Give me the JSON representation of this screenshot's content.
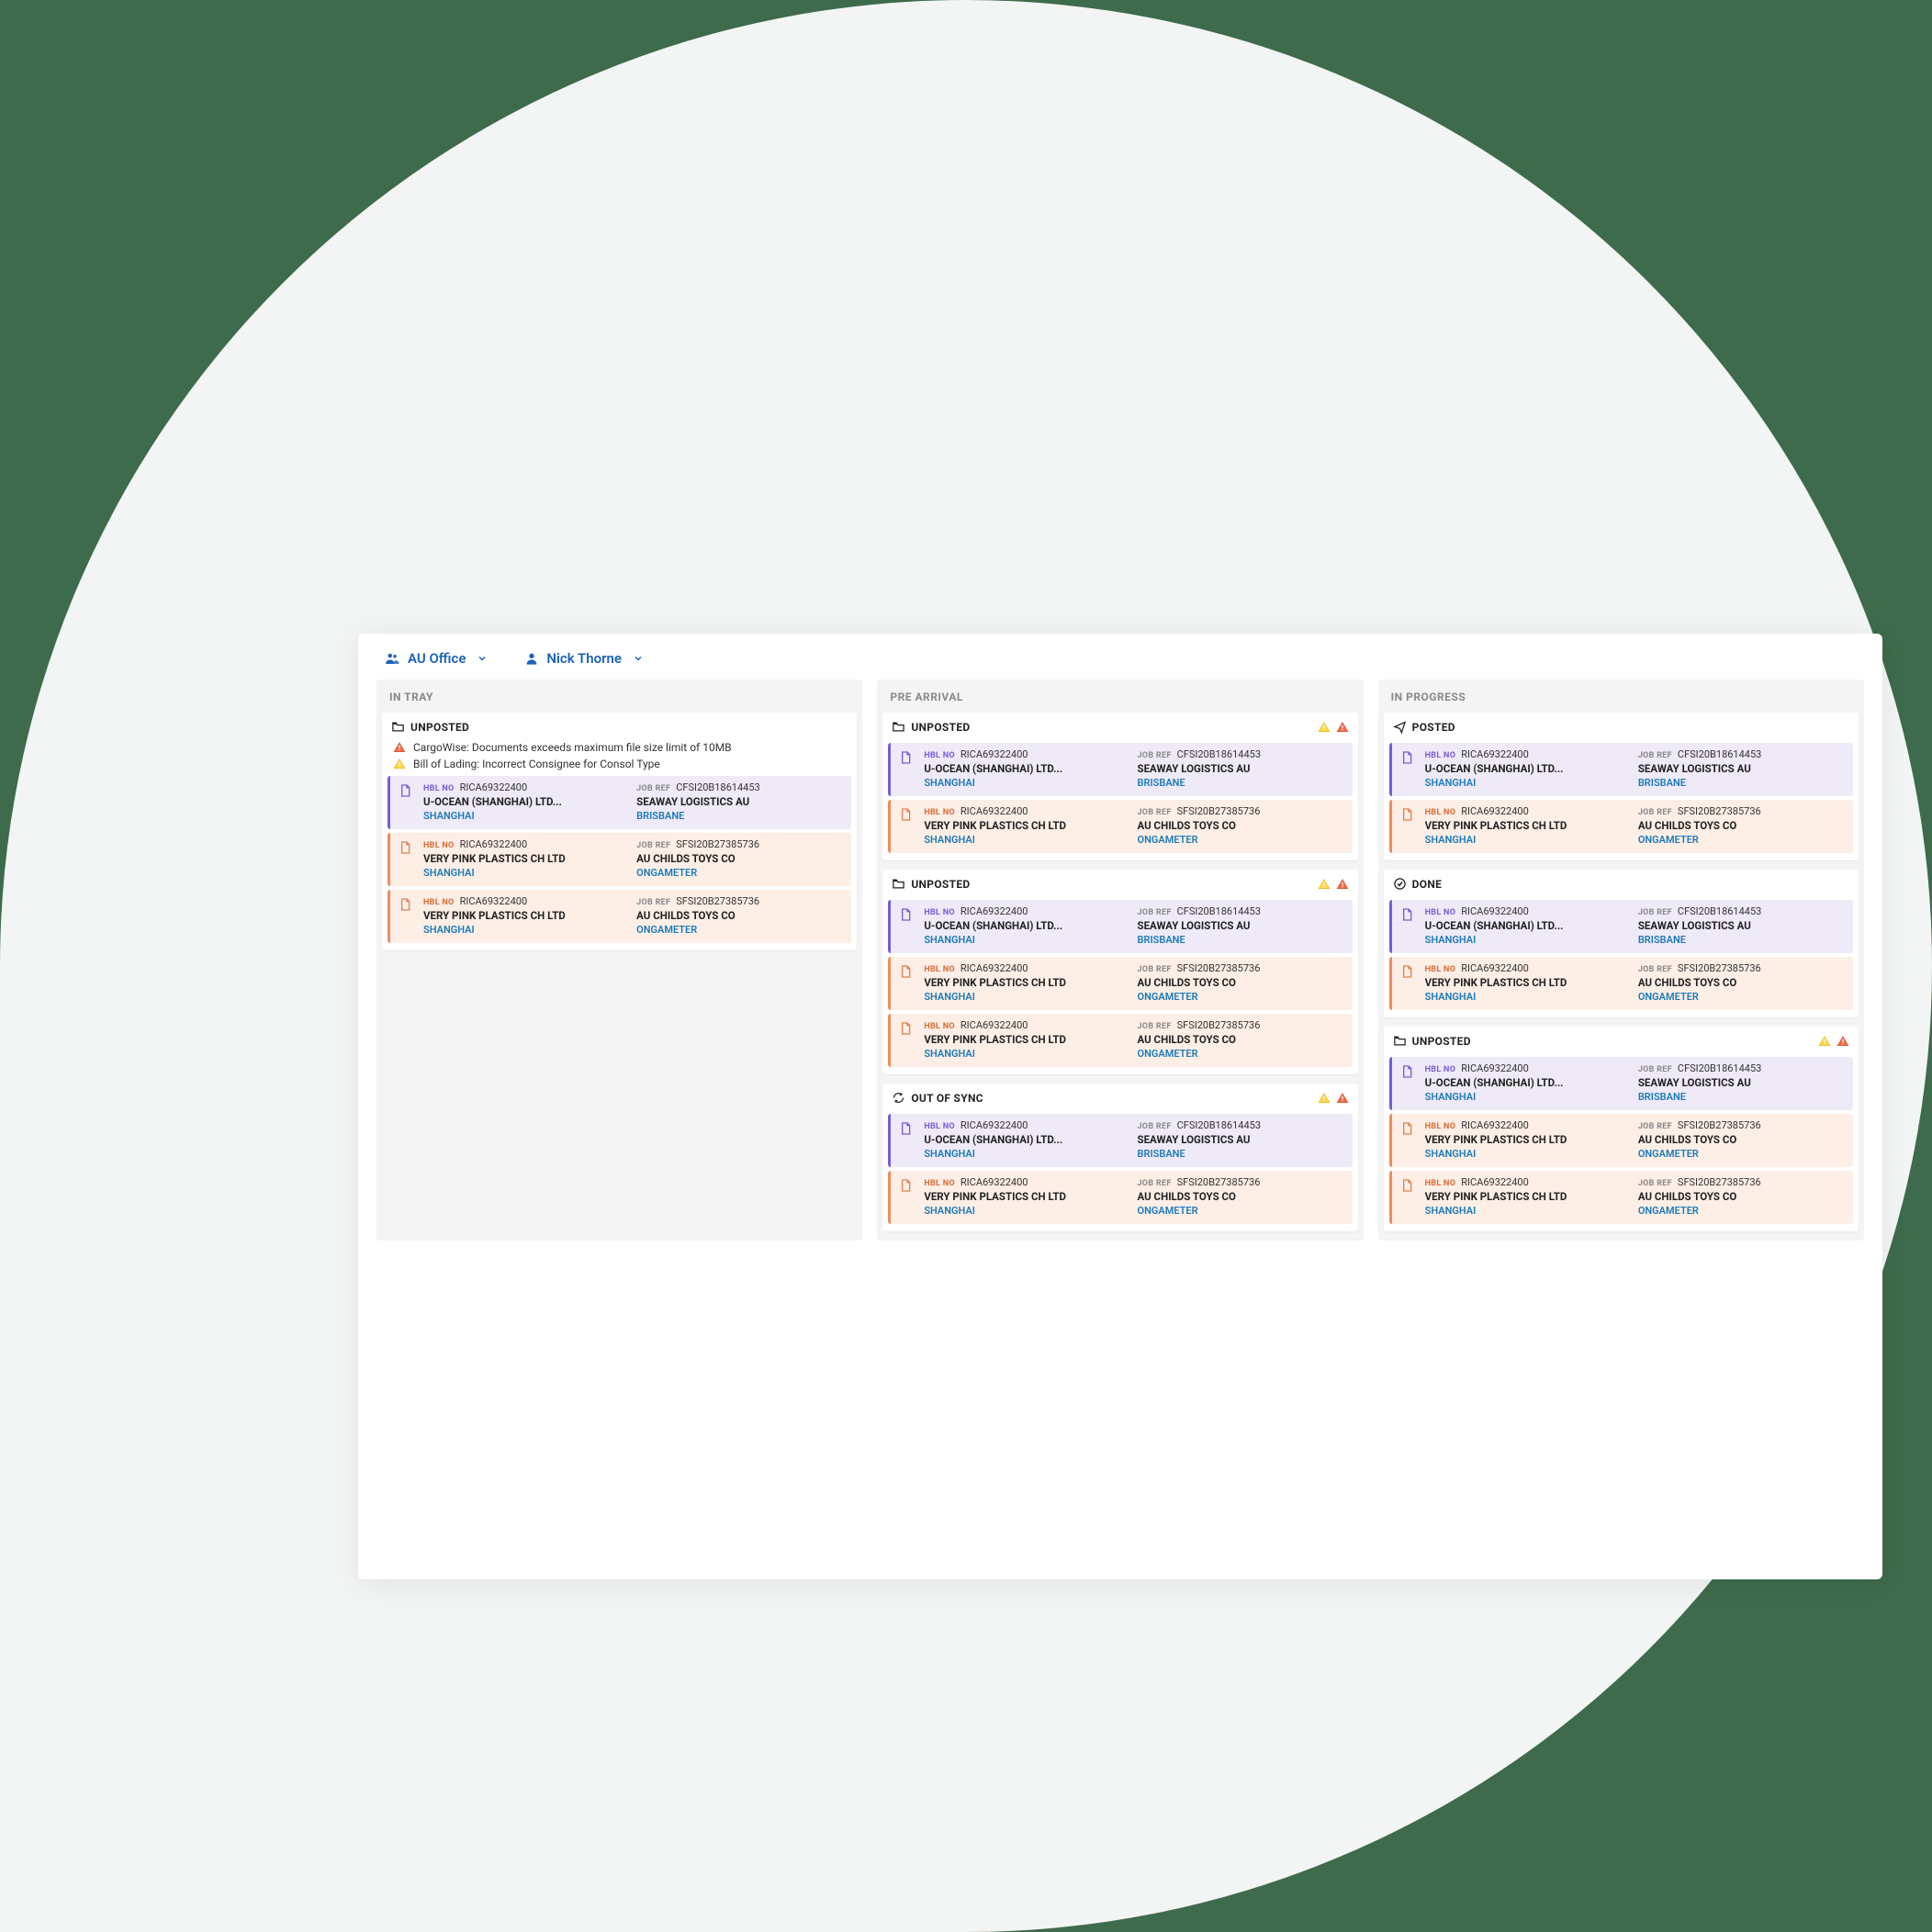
{
  "topbar": {
    "office": "AU Office",
    "user": "Nick Thorne"
  },
  "labels": {
    "hbl": "HBL NO",
    "jobref": "JOB REF"
  },
  "columns": [
    {
      "title": "IN TRAY",
      "groups": [
        {
          "icon": "folder",
          "title": "UNPOSTED",
          "warnings": [
            "CargoWise: Documents exceeds maximum file size limit of 10MB",
            "Bill of Lading: Incorrect Consignee for Consol Type"
          ],
          "header_alerts": [],
          "cards": [
            {
              "variant": "purple",
              "hbl": "RICA69322400",
              "jobref": "CFSI20B18614453",
              "shipper": "U-OCEAN (SHANGHAI) LTD...",
              "consignee": "SEAWAY LOGISTICS AU",
              "origin": "SHANGHAI",
              "dest": "BRISBANE"
            },
            {
              "variant": "peach",
              "hbl": "RICA69322400",
              "jobref": "SFSI20B27385736",
              "shipper": "VERY PINK PLASTICS CH LTD",
              "consignee": "AU CHILDS TOYS CO",
              "origin": "SHANGHAI",
              "dest": "ONGAMETER"
            },
            {
              "variant": "peach",
              "hbl": "RICA69322400",
              "jobref": "SFSI20B27385736",
              "shipper": "VERY PINK PLASTICS CH LTD",
              "consignee": "AU CHILDS TOYS CO",
              "origin": "SHANGHAI",
              "dest": "ONGAMETER"
            }
          ]
        }
      ]
    },
    {
      "title": "PRE ARRIVAL",
      "groups": [
        {
          "icon": "folder",
          "title": "UNPOSTED",
          "warnings": [],
          "header_alerts": [
            "yellow",
            "red"
          ],
          "cards": [
            {
              "variant": "purple",
              "hbl": "RICA69322400",
              "jobref": "CFSI20B18614453",
              "shipper": "U-OCEAN (SHANGHAI) LTD...",
              "consignee": "SEAWAY LOGISTICS AU",
              "origin": "SHANGHAI",
              "dest": "BRISBANE"
            },
            {
              "variant": "peach",
              "hbl": "RICA69322400",
              "jobref": "SFSI20B27385736",
              "shipper": "VERY PINK PLASTICS CH LTD",
              "consignee": "AU CHILDS TOYS CO",
              "origin": "SHANGHAI",
              "dest": "ONGAMETER"
            }
          ]
        },
        {
          "icon": "folder",
          "title": "UNPOSTED",
          "warnings": [],
          "header_alerts": [
            "yellow",
            "red"
          ],
          "cards": [
            {
              "variant": "purple",
              "hbl": "RICA69322400",
              "jobref": "CFSI20B18614453",
              "shipper": "U-OCEAN (SHANGHAI) LTD...",
              "consignee": "SEAWAY LOGISTICS AU",
              "origin": "SHANGHAI",
              "dest": "BRISBANE"
            },
            {
              "variant": "peach",
              "hbl": "RICA69322400",
              "jobref": "SFSI20B27385736",
              "shipper": "VERY PINK PLASTICS CH LTD",
              "consignee": "AU CHILDS TOYS CO",
              "origin": "SHANGHAI",
              "dest": "ONGAMETER"
            },
            {
              "variant": "peach",
              "hbl": "RICA69322400",
              "jobref": "SFSI20B27385736",
              "shipper": "VERY PINK PLASTICS CH LTD",
              "consignee": "AU CHILDS TOYS CO",
              "origin": "SHANGHAI",
              "dest": "ONGAMETER"
            }
          ]
        },
        {
          "icon": "sync",
          "title": "OUT OF SYNC",
          "warnings": [],
          "header_alerts": [
            "yellow",
            "red"
          ],
          "cards": [
            {
              "variant": "purple",
              "hbl": "RICA69322400",
              "jobref": "CFSI20B18614453",
              "shipper": "U-OCEAN (SHANGHAI) LTD...",
              "consignee": "SEAWAY LOGISTICS AU",
              "origin": "SHANGHAI",
              "dest": "BRISBANE"
            },
            {
              "variant": "peach",
              "hbl": "RICA69322400",
              "jobref": "SFSI20B27385736",
              "shipper": "VERY PINK PLASTICS CH LTD",
              "consignee": "AU CHILDS TOYS CO",
              "origin": "SHANGHAI",
              "dest": "ONGAMETER"
            }
          ]
        }
      ]
    },
    {
      "title": "IN PROGRESS",
      "groups": [
        {
          "icon": "plane",
          "title": "POSTED",
          "warnings": [],
          "header_alerts": [],
          "cards": [
            {
              "variant": "purple",
              "hbl": "RICA69322400",
              "jobref": "CFSI20B18614453",
              "shipper": "U-OCEAN (SHANGHAI) LTD...",
              "consignee": "SEAWAY LOGISTICS AU",
              "origin": "SHANGHAI",
              "dest": "BRISBANE"
            },
            {
              "variant": "peach",
              "hbl": "RICA69322400",
              "jobref": "SFSI20B27385736",
              "shipper": "VERY PINK PLASTICS CH LTD",
              "consignee": "AU CHILDS TOYS CO",
              "origin": "SHANGHAI",
              "dest": "ONGAMETER"
            }
          ]
        },
        {
          "icon": "check",
          "title": "DONE",
          "warnings": [],
          "header_alerts": [],
          "cards": [
            {
              "variant": "purple",
              "hbl": "RICA69322400",
              "jobref": "CFSI20B18614453",
              "shipper": "U-OCEAN (SHANGHAI) LTD...",
              "consignee": "SEAWAY LOGISTICS AU",
              "origin": "SHANGHAI",
              "dest": "BRISBANE"
            },
            {
              "variant": "peach",
              "hbl": "RICA69322400",
              "jobref": "SFSI20B27385736",
              "shipper": "VERY PINK PLASTICS CH LTD",
              "consignee": "AU CHILDS TOYS CO",
              "origin": "SHANGHAI",
              "dest": "ONGAMETER"
            }
          ]
        },
        {
          "icon": "folder",
          "title": "UNPOSTED",
          "warnings": [],
          "header_alerts": [
            "yellow",
            "red"
          ],
          "cards": [
            {
              "variant": "purple",
              "hbl": "RICA69322400",
              "jobref": "CFSI20B18614453",
              "shipper": "U-OCEAN (SHANGHAI) LTD...",
              "consignee": "SEAWAY LOGISTICS AU",
              "origin": "SHANGHAI",
              "dest": "BRISBANE"
            },
            {
              "variant": "peach",
              "hbl": "RICA69322400",
              "jobref": "SFSI20B27385736",
              "shipper": "VERY PINK PLASTICS CH LTD",
              "consignee": "AU CHILDS TOYS CO",
              "origin": "SHANGHAI",
              "dest": "ONGAMETER"
            },
            {
              "variant": "peach",
              "hbl": "RICA69322400",
              "jobref": "SFSI20B27385736",
              "shipper": "VERY PINK PLASTICS CH LTD",
              "consignee": "AU CHILDS TOYS CO",
              "origin": "SHANGHAI",
              "dest": "ONGAMETER"
            }
          ]
        }
      ]
    }
  ]
}
